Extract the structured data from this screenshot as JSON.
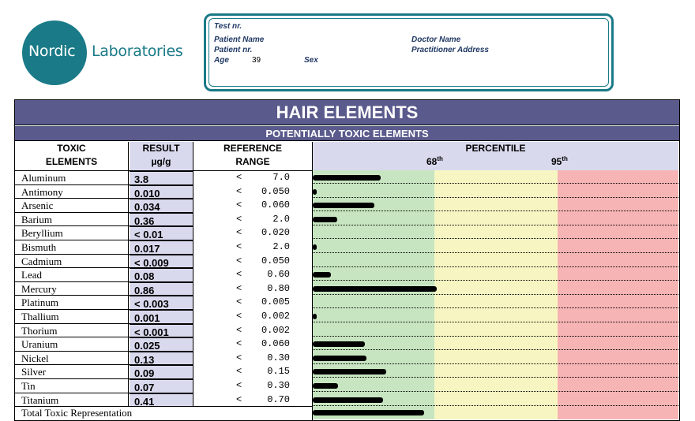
{
  "logo": {
    "word1": "Nordic",
    "word2": "Laboratories"
  },
  "patient": {
    "test_label": "Test nr.",
    "patient_name_label": "Patient Name",
    "patient_nr_label": "Patient nr.",
    "age_label": "Age",
    "age_value": "39",
    "sex_label": "Sex",
    "doctor_name_label": "Doctor Name",
    "practitioner_address_label": "Practitioner Address"
  },
  "report": {
    "title": "HAIR ELEMENTS",
    "subtitle": "POTENTIALLY TOXIC ELEMENTS",
    "col_toxic_line1": "TOXIC",
    "col_toxic_line2": "ELEMENTS",
    "col_result_line1": "RESULT",
    "col_result_line2": "µg/g",
    "col_ref_line1": "REFERENCE",
    "col_ref_line2": "RANGE",
    "col_percentile": "PERCENTILE",
    "p68": "68",
    "p95": "95",
    "th": "th",
    "lt_symbol": "<"
  },
  "zone_colors": {
    "low": "#c6e5c0",
    "mid": "#f7f6c2",
    "high": "#f6b4b4"
  },
  "elements": [
    {
      "name": "Aluminum",
      "result": "3.8",
      "ref": "7.0",
      "level": 0.185
    },
    {
      "name": "Antimony",
      "result": "0.010",
      "ref": "0.050",
      "level": 0.01
    },
    {
      "name": "Arsenic",
      "result": "0.034",
      "ref": "0.060",
      "level": 0.168
    },
    {
      "name": "Barium",
      "result": "0.36",
      "ref": "2.0",
      "level": 0.067
    },
    {
      "name": "Beryllium",
      "result": "< 0.01",
      "ref": "0.020",
      "level": 0.0
    },
    {
      "name": "Bismuth",
      "result": "0.017",
      "ref": "2.0",
      "level": 0.01
    },
    {
      "name": "Cadmium",
      "result": "< 0.009",
      "ref": "0.050",
      "level": 0.0
    },
    {
      "name": "Lead",
      "result": "0.08",
      "ref": "0.60",
      "level": 0.05
    },
    {
      "name": "Mercury",
      "result": "0.86",
      "ref": "0.80",
      "level": 0.34
    },
    {
      "name": "Platinum",
      "result": "< 0.003",
      "ref": "0.005",
      "level": 0.0
    },
    {
      "name": "Thallium",
      "result": "0.001",
      "ref": "0.002",
      "level": 0.01
    },
    {
      "name": "Thorium",
      "result": "< 0.001",
      "ref": "0.002",
      "level": 0.0
    },
    {
      "name": "Uranium",
      "result": "0.025",
      "ref": "0.060",
      "level": 0.143
    },
    {
      "name": "Nickel",
      "result": "0.13",
      "ref": "0.30",
      "level": 0.147
    },
    {
      "name": "Silver",
      "result": "0.09",
      "ref": "0.15",
      "level": 0.2
    },
    {
      "name": "Tin",
      "result": "0.07",
      "ref": "0.30",
      "level": 0.07
    },
    {
      "name": "Titanium",
      "result": "0.41",
      "ref": "0.70",
      "level": 0.193
    }
  ],
  "total": {
    "name": "Total Toxic Representation",
    "level": 0.305
  }
}
